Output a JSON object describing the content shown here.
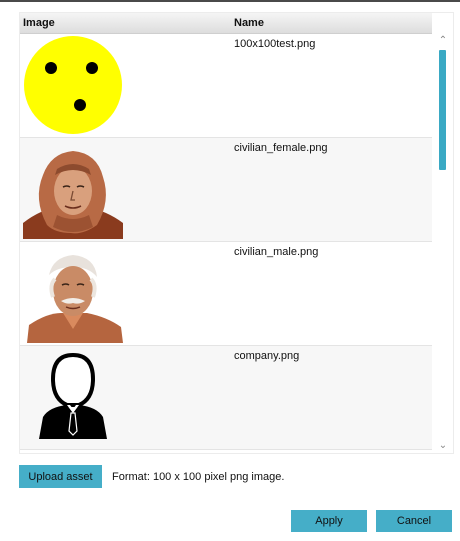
{
  "table": {
    "headers": {
      "image": "Image",
      "name": "Name"
    },
    "rows": [
      {
        "name": "100x100test.png",
        "image_icon": "smiley-test-image"
      },
      {
        "name": "civilian_female.png",
        "image_icon": "female-civilian-portrait"
      },
      {
        "name": "civilian_male.png",
        "image_icon": "male-civilian-portrait"
      },
      {
        "name": "company.png",
        "image_icon": "person-silhouette-icon"
      }
    ]
  },
  "scrollbar": {
    "up_icon": "chevron-up-icon",
    "down_icon": "chevron-down-icon",
    "thumb_color": "#3aa9c4"
  },
  "upload": {
    "button_label": "Upload asset",
    "format_text": "Format: 100 x 100 pixel png image."
  },
  "actions": {
    "apply_label": "Apply",
    "cancel_label": "Cancel"
  },
  "colors": {
    "accent": "#45aec8"
  }
}
